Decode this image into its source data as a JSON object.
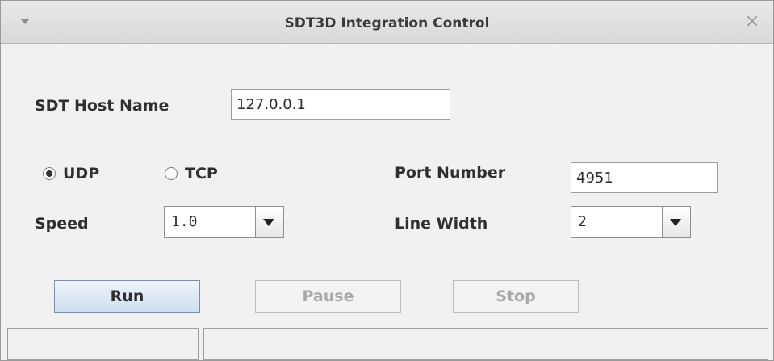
{
  "window": {
    "title": "SDT3D Integration Control"
  },
  "form": {
    "host_label": "SDT Host Name",
    "host_value": "127.0.0.1",
    "protocol_udp_label": "UDP",
    "protocol_tcp_label": "TCP",
    "selected_protocol": "UDP",
    "port_label": "Port Number",
    "port_value": "4951",
    "speed_label": "Speed",
    "speed_value": "1.0",
    "line_width_label": "Line Width",
    "line_width_value": "2"
  },
  "buttons": {
    "run": "Run",
    "pause": "Pause",
    "stop": "Stop"
  },
  "statusbar": {
    "left": "",
    "right": ""
  },
  "icons": {
    "menu": "chevron-down-icon",
    "close": "close-icon",
    "dropdown": "chevron-down-icon"
  }
}
